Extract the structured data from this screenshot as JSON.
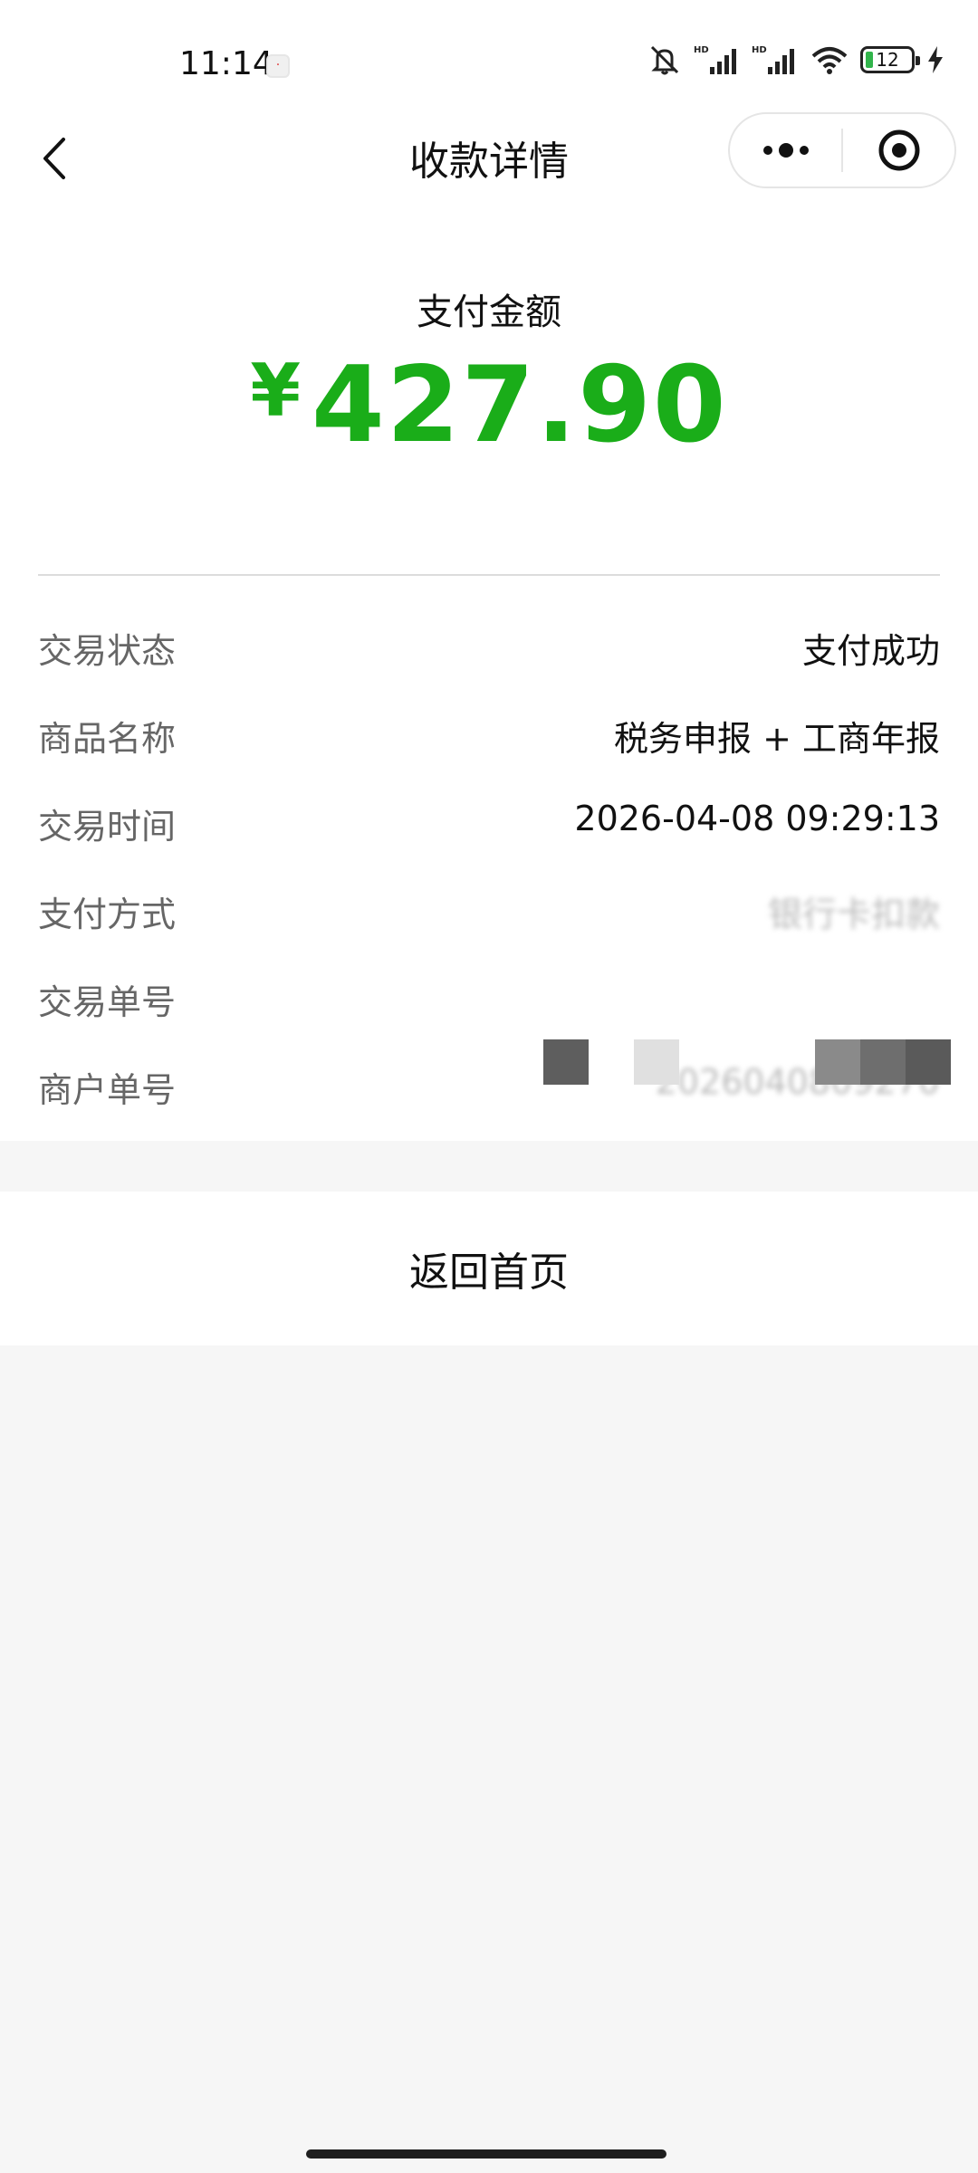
{
  "status_bar": {
    "time": "11:14",
    "battery_level": "12"
  },
  "nav": {
    "title": "收款详情",
    "icons": [
      "back-arrow-icon",
      "more-dots-icon",
      "close-target-icon"
    ]
  },
  "payment": {
    "amount_label": "支付金额",
    "currency": "¥",
    "amount": "427.90",
    "accent_color": "#1aad19"
  },
  "details": [
    {
      "label": "交易状态",
      "value": "支付成功"
    },
    {
      "label": "商品名称",
      "value": "税务申报 + 工商年报"
    },
    {
      "label": "交易时间",
      "value": "2026-04-08 09:29:13"
    },
    {
      "label": "支付方式",
      "value": "银行卡扣款"
    },
    {
      "label": "交易单号",
      "value": ""
    },
    {
      "label": "商户单号",
      "value": "2026040809270"
    }
  ],
  "footer": {
    "home_button": "返回首页"
  }
}
